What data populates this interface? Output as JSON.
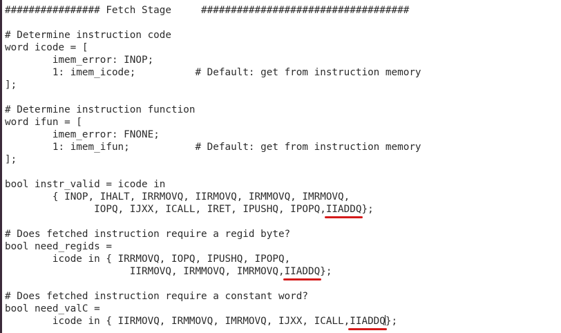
{
  "lines": [
    "################ Fetch Stage     ###################################",
    "",
    "# Determine instruction code",
    "word icode = [",
    "\timem_error: INOP;",
    "\t1: imem_icode;\t\t# Default: get from instruction memory",
    "];",
    "",
    "# Determine instruction function",
    "word ifun = [",
    "\timem_error: FNONE;",
    "\t1: imem_ifun;\t\t# Default: get from instruction memory",
    "];",
    "",
    "bool instr_valid = icode in",
    "\t{ INOP, IHALT, IRRMOVQ, IIRMOVQ, IRMMOVQ, IMRMOVQ,",
    "\t       IOPQ, IJXX, ICALL, IRET, IPUSHQ, IPOPQ,",
    "",
    "# Does fetched instruction require a regid byte?",
    "bool need_regids =",
    "\ticode in { IRRMOVQ, IOPQ, IPUSHQ, IPOPQ,",
    "\t\t     IIRMOVQ, IRMMOVQ, IMRMOVQ,",
    "",
    "# Does fetched instruction require a constant word?",
    "bool need_valC =",
    "\ticode in { IIRMOVQ, IRMMOVQ, IMRMOVQ, IJXX, ICALL,"
  ],
  "annotated": {
    "instr_valid_new": "IIADDQ",
    "instr_valid_tail": "};",
    "need_regids_new": "IIADDQ",
    "need_regids_tail": "};",
    "need_valC_new_a": "IIADDQ",
    "need_valC_new_b": "",
    "need_valC_tail": "};"
  },
  "colors": {
    "annotation": "#d41a1a",
    "text": "#2b2b2b",
    "background": "#ffffff"
  }
}
